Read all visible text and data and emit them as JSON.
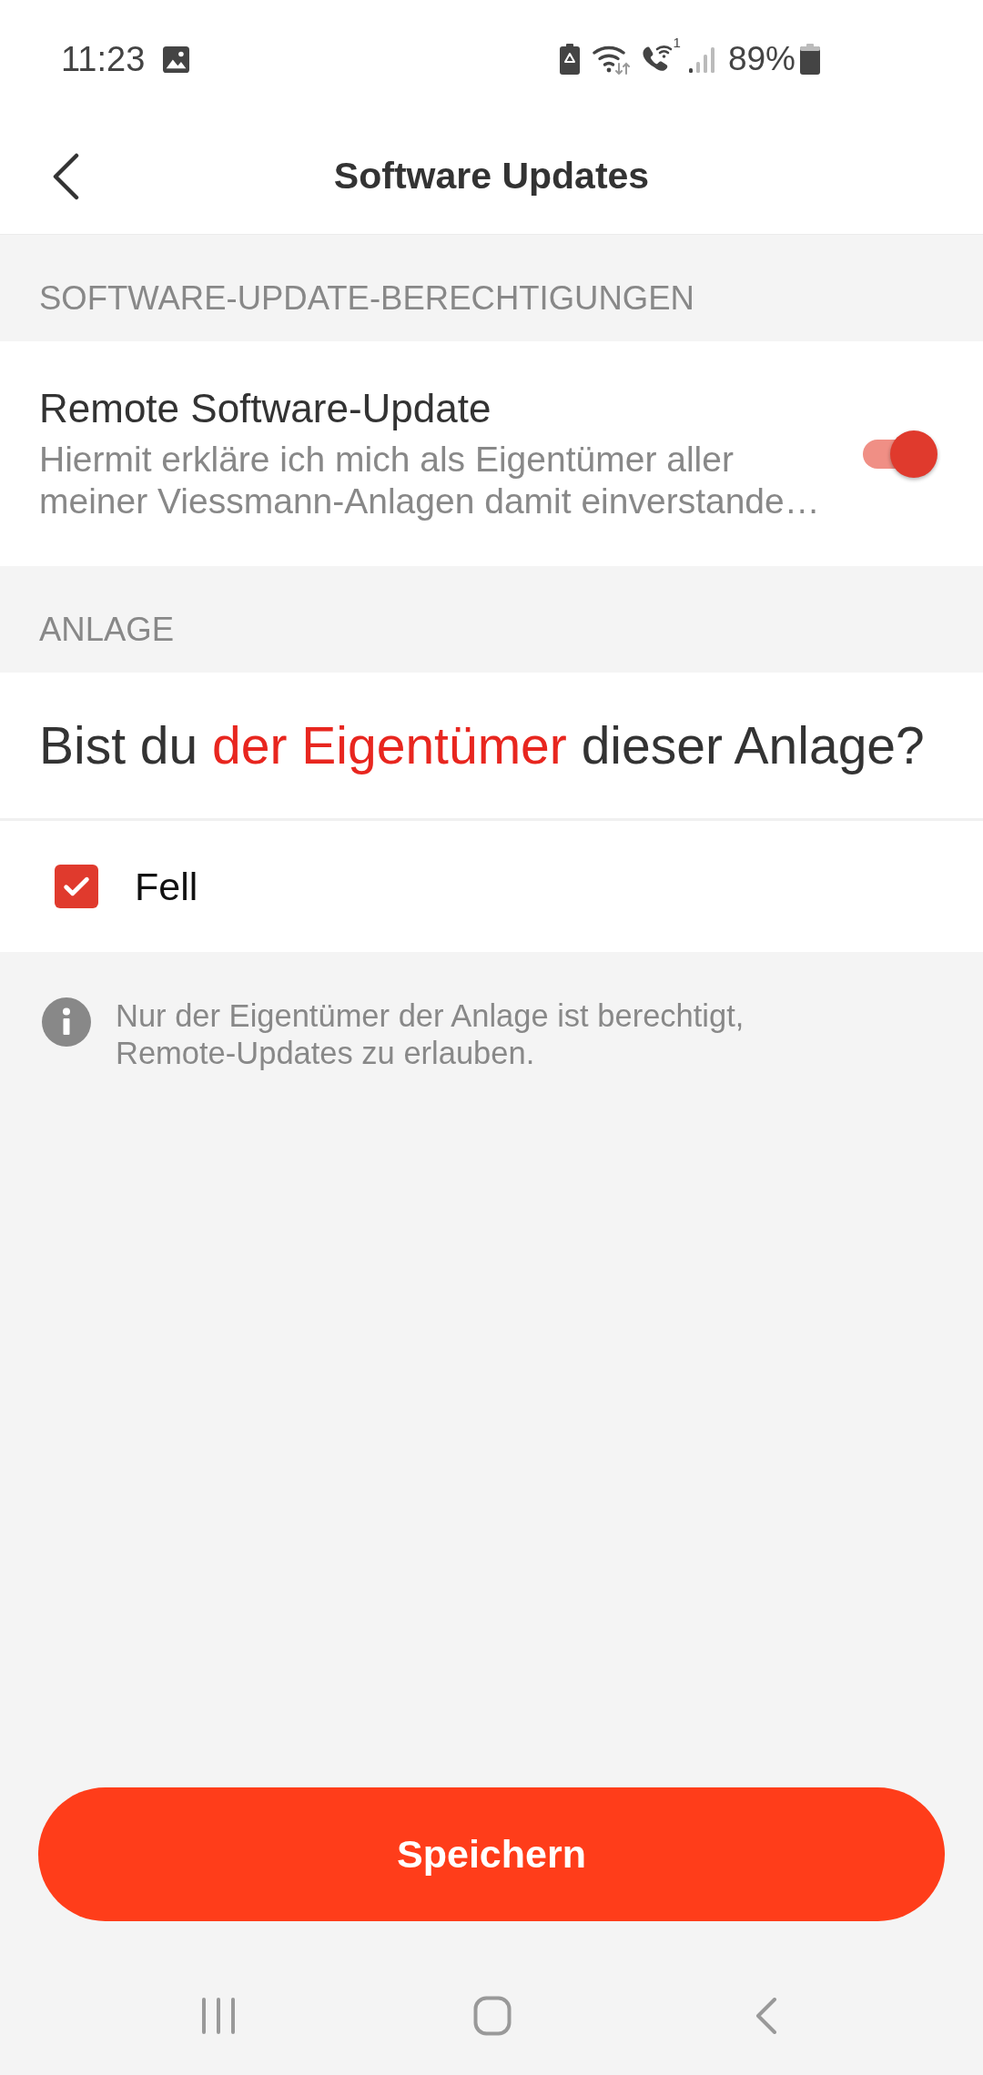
{
  "status_bar": {
    "time": "11:23",
    "sim_number": "1",
    "battery": "89%"
  },
  "header": {
    "title": "Software Updates"
  },
  "sections": [
    {
      "heading": "SOFTWARE-UPDATE-BERECHTIGUNGEN",
      "items": [
        {
          "kind": "toggle",
          "title": "Remote Software-Update",
          "description_lines": [
            "Hiermit erkläre ich mich als Eigentümer aller",
            "meiner Viessmann-Anlagen damit einverstande…"
          ],
          "on": true
        }
      ]
    },
    {
      "heading": "ANLAGE",
      "items": [
        {
          "kind": "question",
          "parts": [
            {
              "text": "Bist du ",
              "accent": false
            },
            {
              "text": "der Eigentümer",
              "accent": true
            },
            {
              "text": " dieser Anlage?",
              "accent": false
            }
          ]
        },
        {
          "kind": "checkbox",
          "label": "Fell",
          "checked": true
        }
      ]
    }
  ],
  "info": {
    "lines": [
      "Nur der Eigentümer der Anlage ist berechtigt,",
      "Remote-Updates zu erlauben."
    ]
  },
  "save_button": {
    "label": "Speichern"
  }
}
